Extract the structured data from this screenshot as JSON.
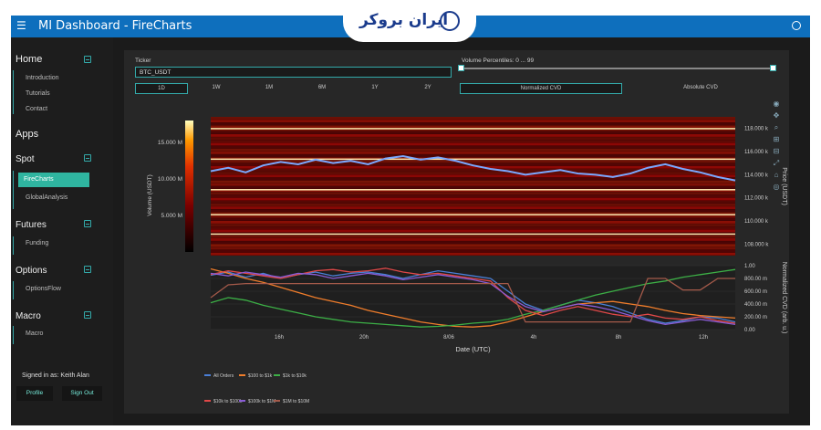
{
  "app": {
    "title": "MI Dashboard  -  FireCharts"
  },
  "logo": {
    "text": "ایران بروکر"
  },
  "sidebar": {
    "home": "Home",
    "home_items": [
      "Introduction",
      "Tutorials",
      "Contact"
    ],
    "apps": "Apps",
    "spot": "Spot",
    "spot_items": [
      "FireCharts",
      "GlobalAnalysis"
    ],
    "futures": "Futures",
    "futures_items": [
      "Funding"
    ],
    "options": "Options",
    "options_items": [
      "OptionsFlow"
    ],
    "macro": "Macro",
    "macro_items": [
      "Macro"
    ],
    "signed_in": "Signed in as: Keith Alan",
    "profile": "Profile",
    "sign_out": "Sign Out"
  },
  "controls": {
    "ticker_label": "Ticker",
    "ticker_value": "BTC_USDT",
    "percentile_label": "Volume Percentiles: 0 ... 99",
    "timeframes": [
      "1D",
      "1W",
      "1M",
      "6M",
      "1Y",
      "2Y"
    ],
    "active_timeframe": "1D",
    "cvd_normalized": "Normalized CVD",
    "cvd_absolute": "Absolute CVD"
  },
  "colors": {
    "accent": "#2fb5a0",
    "topbar": "#0e6fbd"
  },
  "chart_data": [
    {
      "type": "heatmap",
      "title": "",
      "xlabel": "Date (UTC)",
      "ylabel_left": "Volume (USDT)",
      "ylabel_right": "Price (USDT)",
      "colorbar_ticks": [
        "15.000 M",
        "10.000 M",
        "5.000 M"
      ],
      "colorbar_values": [
        15,
        10,
        5
      ],
      "colorbar_range": [
        0,
        18
      ],
      "price_ticks": [
        "118.000 k",
        "116.000 k",
        "114.000 k",
        "112.000 k",
        "110.000 k",
        "108.000 k"
      ],
      "price_values": [
        118,
        116,
        114,
        112,
        110,
        108
      ],
      "price_range": [
        107,
        119
      ],
      "price_series": [
        114.3,
        114.6,
        114.2,
        114.8,
        115.1,
        114.9,
        115.3,
        115.0,
        115.2,
        114.9,
        115.4,
        115.6,
        115.3,
        115.5,
        115.2,
        114.8,
        114.5,
        114.3,
        114.0,
        114.2,
        114.4,
        114.1,
        114.0,
        113.8,
        114.1,
        114.6,
        114.9,
        114.5,
        114.2,
        113.8,
        113.5
      ]
    },
    {
      "type": "line",
      "xlabel": "Date (UTC)",
      "ylabel": "Normalized CVD (arb. u.)",
      "y_ticks": [
        "1.00",
        "800.00 m",
        "600.00 m",
        "400.00 m",
        "200.00 m",
        "0.00"
      ],
      "y_values": [
        1.0,
        0.8,
        0.6,
        0.4,
        0.2,
        0.0
      ],
      "ylim": [
        0,
        1
      ],
      "x_ticks": [
        "16h",
        "20h",
        "8/06",
        "4h",
        "8h",
        "12h"
      ],
      "series": [
        {
          "name": "All Orders",
          "color": "#4a7fd6",
          "values": [
            0.85,
            0.9,
            0.82,
            0.88,
            0.8,
            0.86,
            0.9,
            0.84,
            0.88,
            0.9,
            0.86,
            0.8,
            0.86,
            0.92,
            0.88,
            0.84,
            0.8,
            0.6,
            0.4,
            0.3,
            0.38,
            0.46,
            0.42,
            0.36,
            0.26,
            0.16,
            0.1,
            0.14,
            0.2,
            0.18,
            0.12
          ]
        },
        {
          "name": "$100 to $1k",
          "color": "#f07d2b",
          "values": [
            0.95,
            0.88,
            0.8,
            0.74,
            0.66,
            0.58,
            0.5,
            0.44,
            0.38,
            0.3,
            0.24,
            0.18,
            0.12,
            0.08,
            0.05,
            0.04,
            0.06,
            0.12,
            0.2,
            0.28,
            0.34,
            0.4,
            0.42,
            0.44,
            0.4,
            0.36,
            0.3,
            0.25,
            0.22,
            0.2,
            0.18
          ]
        },
        {
          "name": "$1k to $10k",
          "color": "#3caf46",
          "values": [
            0.42,
            0.5,
            0.46,
            0.38,
            0.32,
            0.26,
            0.2,
            0.16,
            0.12,
            0.1,
            0.08,
            0.06,
            0.04,
            0.05,
            0.07,
            0.1,
            0.12,
            0.16,
            0.24,
            0.3,
            0.38,
            0.46,
            0.54,
            0.6,
            0.66,
            0.72,
            0.76,
            0.82,
            0.86,
            0.9,
            0.94
          ]
        },
        {
          "name": "$10k to $100k",
          "color": "#e04848",
          "values": [
            0.86,
            0.92,
            0.88,
            0.84,
            0.8,
            0.86,
            0.92,
            0.94,
            0.9,
            0.92,
            0.96,
            0.9,
            0.86,
            0.88,
            0.84,
            0.8,
            0.76,
            0.5,
            0.3,
            0.22,
            0.3,
            0.36,
            0.3,
            0.24,
            0.2,
            0.24,
            0.18,
            0.16,
            0.2,
            0.14,
            0.1
          ]
        },
        {
          "name": "$100k to $1M",
          "color": "#8a5cd6",
          "values": [
            0.88,
            0.84,
            0.9,
            0.86,
            0.82,
            0.88,
            0.86,
            0.8,
            0.84,
            0.88,
            0.84,
            0.78,
            0.82,
            0.86,
            0.82,
            0.78,
            0.72,
            0.52,
            0.36,
            0.28,
            0.34,
            0.4,
            0.36,
            0.3,
            0.22,
            0.14,
            0.08,
            0.12,
            0.16,
            0.12,
            0.08
          ]
        },
        {
          "name": "$1M to $10M",
          "color": "#a55a4a",
          "values": [
            0.5,
            0.7,
            0.72,
            0.72,
            0.72,
            0.72,
            0.72,
            0.72,
            0.72,
            0.72,
            0.72,
            0.72,
            0.72,
            0.72,
            0.72,
            0.72,
            0.72,
            0.72,
            0.12,
            0.12,
            0.12,
            0.12,
            0.12,
            0.12,
            0.12,
            0.8,
            0.8,
            0.62,
            0.62,
            0.8,
            0.8
          ]
        }
      ],
      "legend_position": "bottom"
    }
  ]
}
